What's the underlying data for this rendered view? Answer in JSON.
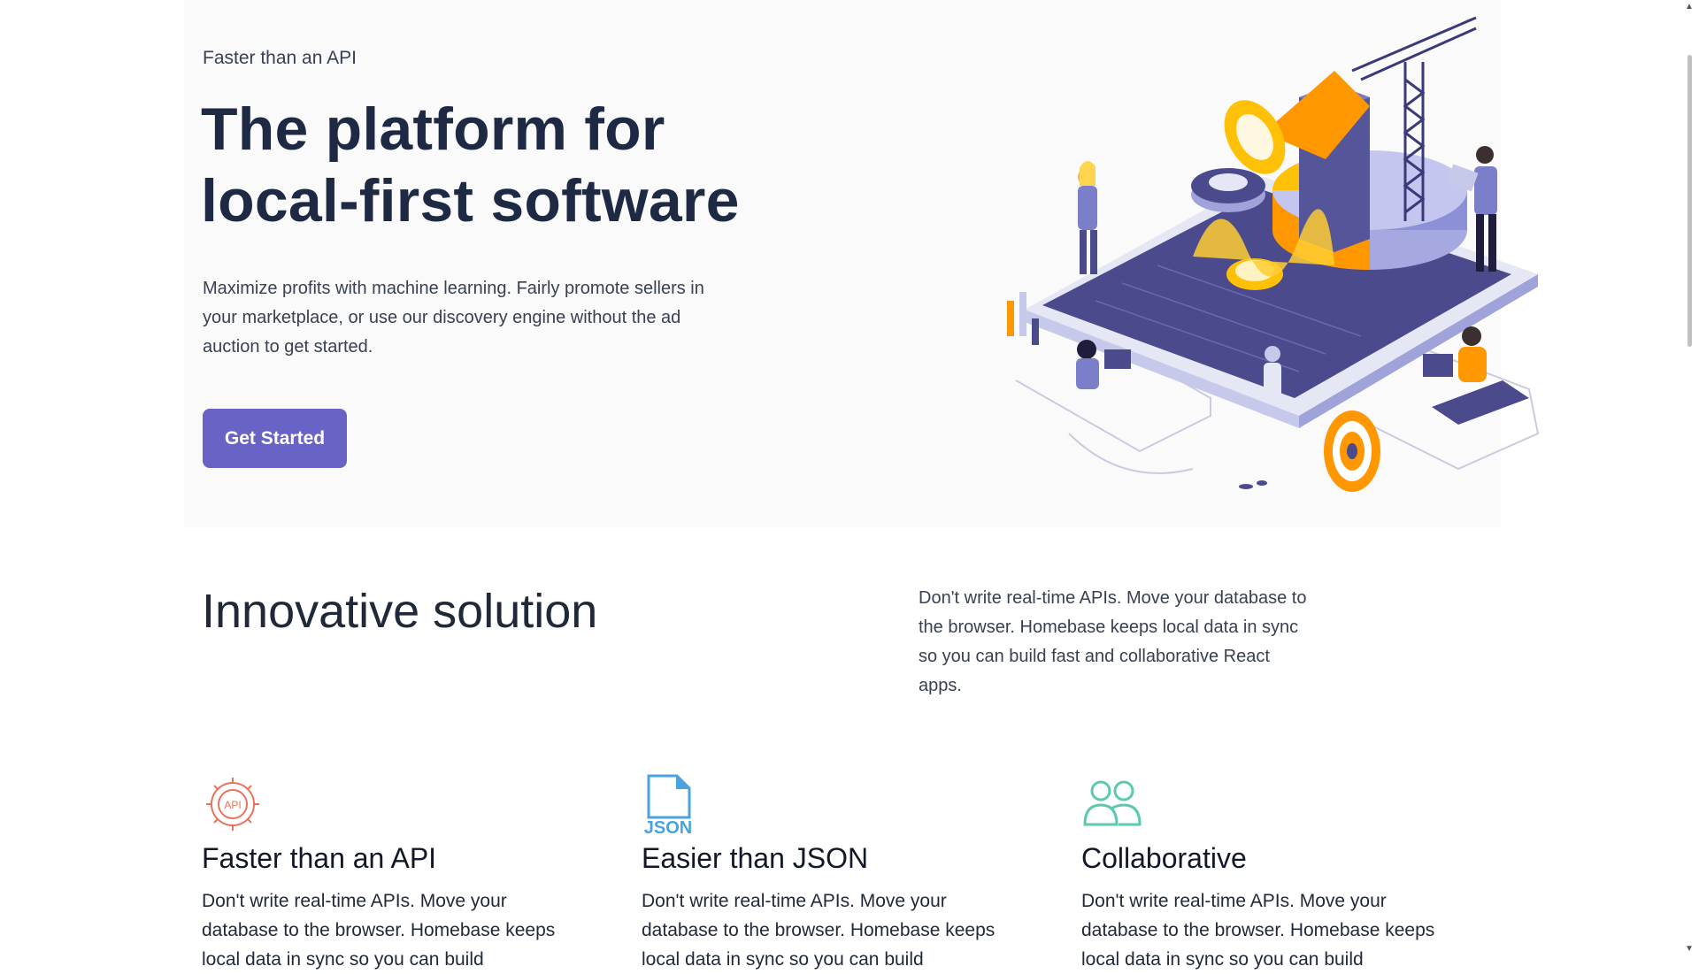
{
  "hero": {
    "eyebrow": "Faster than an API",
    "title_line1": "The platform for",
    "title_line2": "local-first software",
    "description": "Maximize profits with machine learning. Fairly promote sellers in your marketplace, or use our discovery engine without the ad auction to get started.",
    "cta_label": "Get Started"
  },
  "section": {
    "title": "Innovative solution",
    "description": "Don't write real-time APIs. Move your database to the browser. Homebase keeps local data in sync so you can build fast and collaborative React apps."
  },
  "features": [
    {
      "icon": "api-gear-icon",
      "icon_text": "API",
      "title": "Faster than an API",
      "text": "Don't write real-time APIs. Move your database to the browser. Homebase keeps local data in sync so you can build"
    },
    {
      "icon": "json-file-icon",
      "icon_text": "JSON",
      "title": "Easier than JSON",
      "text": "Don't write real-time APIs. Move your database to the browser. Homebase keeps local data in sync so you can build"
    },
    {
      "icon": "users-icon",
      "title": "Collaborative",
      "text": "Don't write real-time APIs. Move your database to the browser. Homebase keeps local data in sync so you can build"
    }
  ],
  "colors": {
    "primary_button": "#6a63c6",
    "heading": "#1e2a44",
    "api_icon": "#e8735a",
    "json_icon": "#4aa3df",
    "users_icon": "#5cc9b0",
    "illustration_purple": "#4a4a8c",
    "illustration_orange": "#ff9800"
  }
}
